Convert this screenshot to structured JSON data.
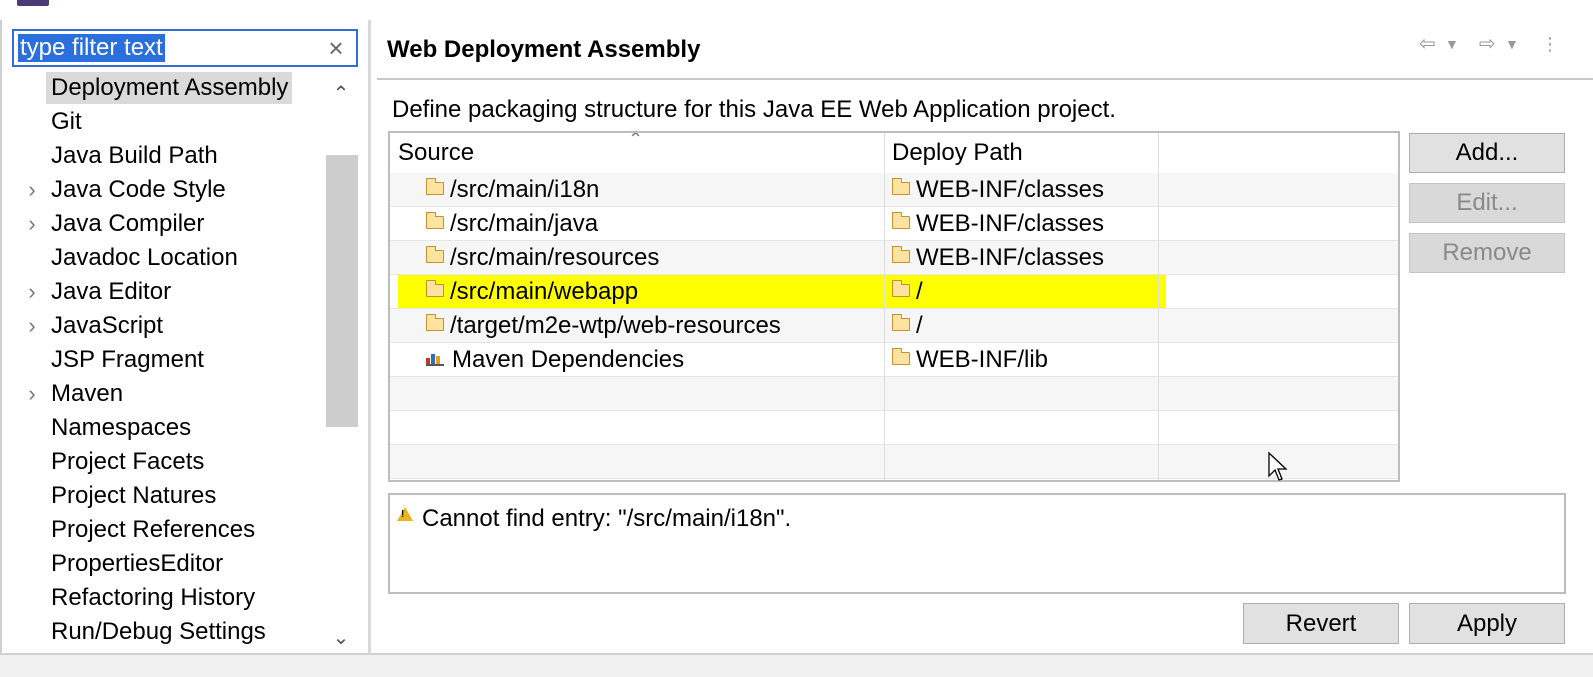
{
  "filter": {
    "value": "type filter text",
    "clear_icon": "×"
  },
  "tree": {
    "items": [
      {
        "label": "Deployment Assembly",
        "expandable": false,
        "selected": true
      },
      {
        "label": "Git",
        "expandable": false
      },
      {
        "label": "Java Build Path",
        "expandable": false
      },
      {
        "label": "Java Code Style",
        "expandable": true
      },
      {
        "label": "Java Compiler",
        "expandable": true
      },
      {
        "label": "Javadoc Location",
        "expandable": false
      },
      {
        "label": "Java Editor",
        "expandable": true
      },
      {
        "label": "JavaScript",
        "expandable": true
      },
      {
        "label": "JSP Fragment",
        "expandable": false
      },
      {
        "label": "Maven",
        "expandable": true
      },
      {
        "label": "Namespaces",
        "expandable": false
      },
      {
        "label": "Project Facets",
        "expandable": false
      },
      {
        "label": "Project Natures",
        "expandable": false
      },
      {
        "label": "Project References",
        "expandable": false
      },
      {
        "label": "PropertiesEditor",
        "expandable": false
      },
      {
        "label": "Refactoring History",
        "expandable": false
      },
      {
        "label": "Run/Debug Settings",
        "expandable": false
      }
    ]
  },
  "page": {
    "title": "Web Deployment Assembly",
    "description": "Define packaging structure for this Java EE Web Application project."
  },
  "table": {
    "columns": [
      "Source",
      "Deploy Path"
    ],
    "rows": [
      {
        "source": "/src/main/i18n",
        "deploy": "WEB-INF/classes",
        "icon": "folder-icon"
      },
      {
        "source": "/src/main/java",
        "deploy": "WEB-INF/classes",
        "icon": "folder-icon"
      },
      {
        "source": "/src/main/resources",
        "deploy": "WEB-INF/classes",
        "icon": "folder-icon"
      },
      {
        "source": "/src/main/webapp",
        "deploy": "/",
        "icon": "folder-icon",
        "highlighted": true
      },
      {
        "source": "/target/m2e-wtp/web-resources",
        "deploy": "/",
        "icon": "folder-icon"
      },
      {
        "source": "Maven Dependencies",
        "deploy": "WEB-INF/lib",
        "icon": "library-icon"
      }
    ],
    "empty_rows": 3
  },
  "buttons": {
    "add": "Add...",
    "edit": "Edit...",
    "remove": "Remove",
    "revert": "Revert",
    "apply": "Apply"
  },
  "message": {
    "icon": "warning-icon",
    "text": "Cannot find entry: \"/src/main/i18n\"."
  },
  "colors": {
    "highlight": "#ffff00",
    "selection": "#2a6fdc",
    "warning": "#e9b41c"
  }
}
